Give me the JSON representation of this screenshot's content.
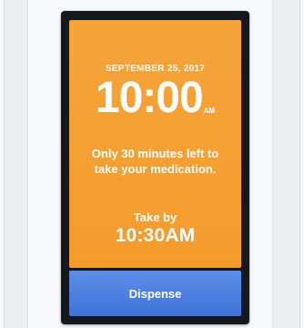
{
  "screen": {
    "date": "SEPTEMBER 25, 2017",
    "time": "10:00",
    "ampm": "AM",
    "message": "Only 30 minutes left to take your medication.",
    "take_by_label": "Take by",
    "deadline": "10:30AM"
  },
  "actions": {
    "dispense_label": "Dispense"
  },
  "colors": {
    "screen_accent": "#f5a033",
    "button_accent": "#4a7fe0",
    "device_frame": "#15181c"
  }
}
